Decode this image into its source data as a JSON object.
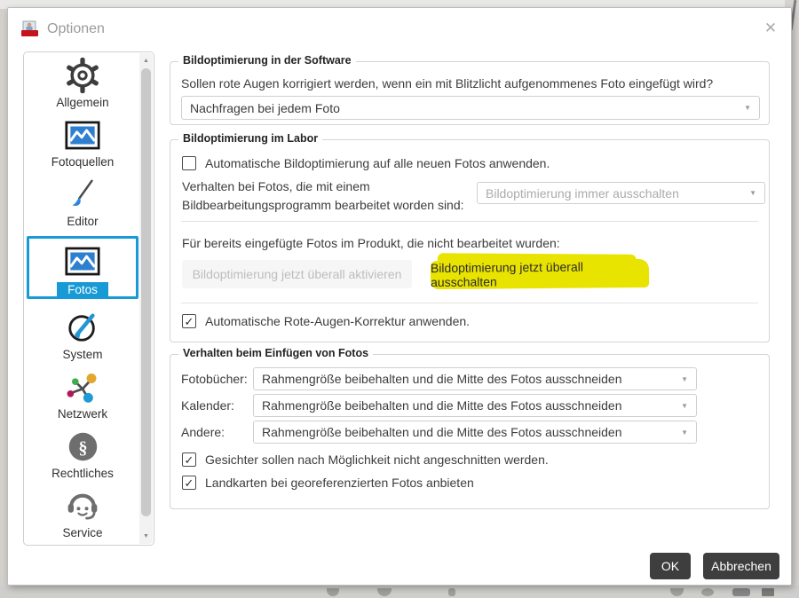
{
  "window": {
    "title": "Optionen",
    "close_glyph": "✕"
  },
  "glyphs": {
    "check": "✓",
    "down": "▼",
    "up": "▲"
  },
  "sidebar": {
    "items": [
      {
        "label": "Allgemein",
        "icon": "gear-icon"
      },
      {
        "label": "Fotoquellen",
        "icon": "photo-icon"
      },
      {
        "label": "Editor",
        "icon": "brush-icon"
      },
      {
        "label": "Fotos",
        "icon": "photo-icon",
        "selected": true
      },
      {
        "label": "System",
        "icon": "gauge-icon"
      },
      {
        "label": "Netzwerk",
        "icon": "network-icon"
      },
      {
        "label": "Rechtliches",
        "icon": "paragraph-icon"
      },
      {
        "label": "Service",
        "icon": "headset-icon"
      },
      {
        "label": "",
        "icon": "info-icon"
      }
    ]
  },
  "groups": {
    "software": {
      "legend": "Bildoptimierung in der Software",
      "question": "Sollen rote Augen korrigiert werden, wenn ein mit Blitzlicht aufgenommenes Foto eingefügt wird?",
      "dropdown_value": "Nachfragen bei jedem Foto"
    },
    "labor": {
      "legend": "Bildoptimierung im Labor",
      "auto_checkbox_label": "Automatische Bildoptimierung auf alle neuen Fotos anwenden.",
      "edited_label_line1": "Verhalten bei Fotos, die mit einem",
      "edited_label_line2": "Bildbearbeitungsprogramm bearbeitet worden sind:",
      "edited_dropdown_value": "Bildoptimierung immer ausschalten",
      "inserted_label": "Für bereits eingefügte Fotos im Produkt, die nicht bearbeitet wurden:",
      "activate_button": "Bildoptimierung jetzt überall aktivieren",
      "deactivate_button": "Bildoptimierung jetzt überall ausschalten",
      "redeye_checkbox_label": "Automatische Rote-Augen-Korrektur anwenden."
    },
    "insert": {
      "legend": "Verhalten beim Einfügen von Fotos",
      "rows": [
        {
          "label": "Fotobücher:",
          "value": "Rahmengröße beibehalten und die Mitte des Fotos ausschneiden"
        },
        {
          "label": "Kalender:",
          "value": "Rahmengröße beibehalten und die Mitte des Fotos ausschneiden"
        },
        {
          "label": "Andere:",
          "value": "Rahmengröße beibehalten und die Mitte des Fotos ausschneiden"
        }
      ],
      "faces_checkbox_label": "Gesichter sollen nach Möglichkeit nicht angeschnitten werden.",
      "maps_checkbox_label": "Landkarten bei georeferenzierten Fotos anbieten"
    }
  },
  "footer": {
    "ok": "OK",
    "cancel": "Abbrechen"
  },
  "colors": {
    "accent_blue": "#189ad6",
    "highlight_yellow": "#e9e300",
    "dark_button": "#3e3e3e"
  }
}
